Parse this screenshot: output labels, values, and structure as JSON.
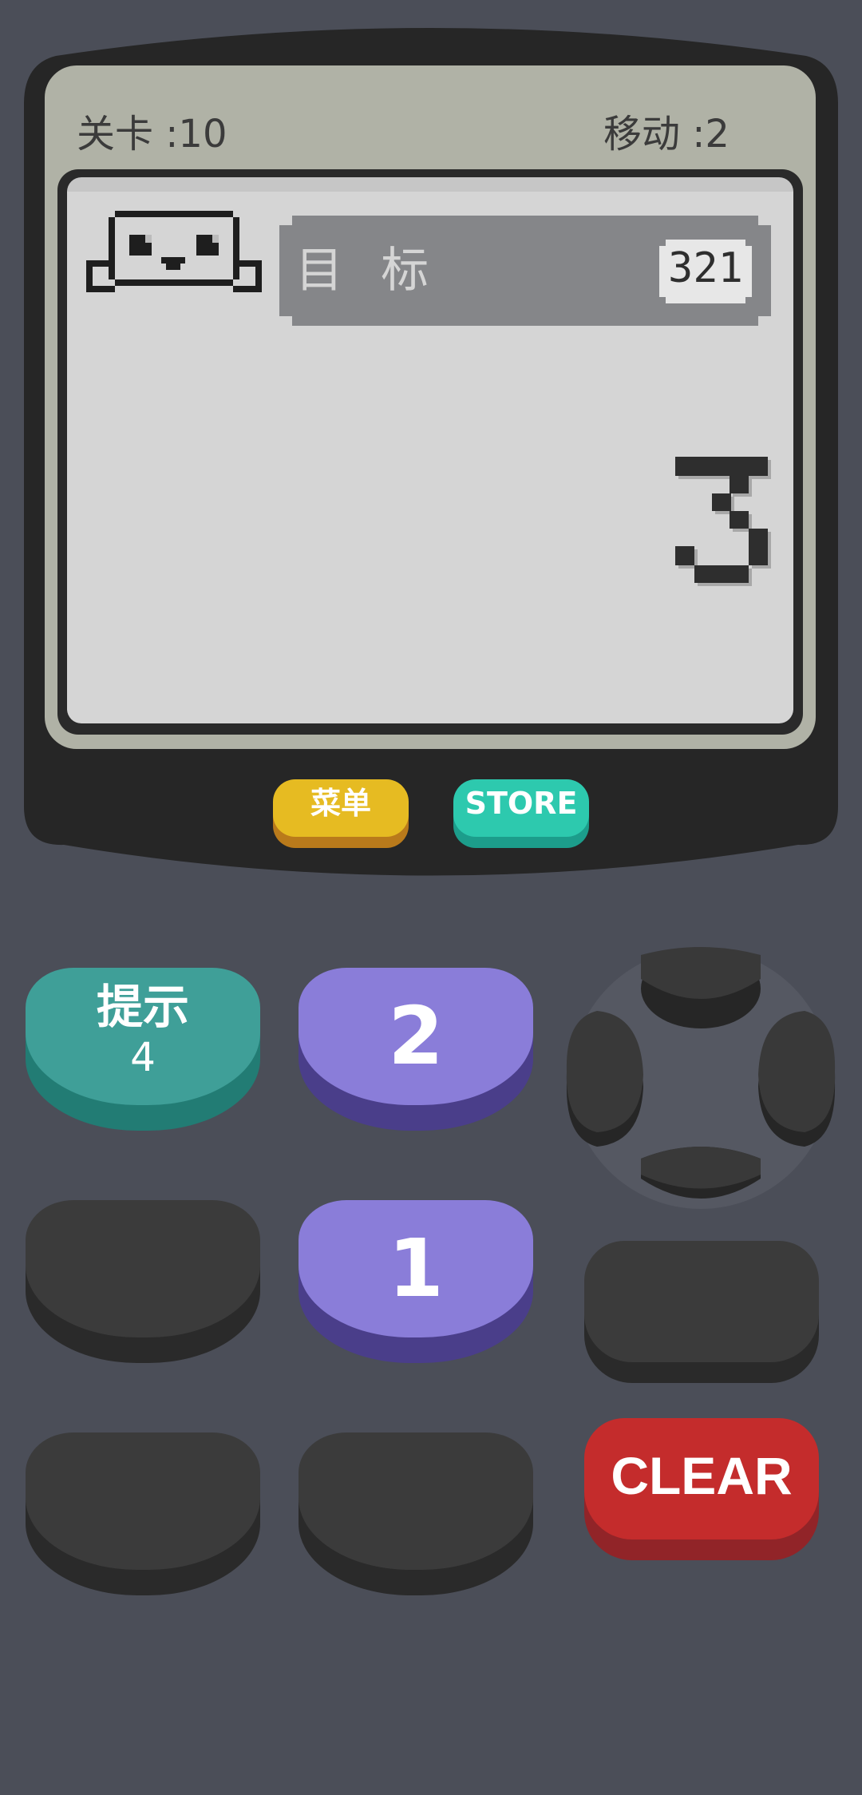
{
  "hud": {
    "level": "关卡 :10",
    "moves": "移动 :2"
  },
  "goal": {
    "label": "目 标",
    "value": "321"
  },
  "display": {
    "current_value": "3"
  },
  "menu_buttons": {
    "menu": "菜单",
    "store": "STORE"
  },
  "keys": {
    "hint_title": "提示",
    "hint_count": "4",
    "key_2": "2",
    "key_1": "1",
    "clear": "CLEAR"
  },
  "colors": {
    "background": "#4b4e58",
    "lcd": "#d5d5d5",
    "menu_button": "#e6bb22",
    "store_button": "#2dc9ae",
    "hint_button": "#3f9f98",
    "number_button": "#8a7dd9",
    "clear_button": "#c42c2c",
    "blank_button": "#3b3b3b"
  }
}
